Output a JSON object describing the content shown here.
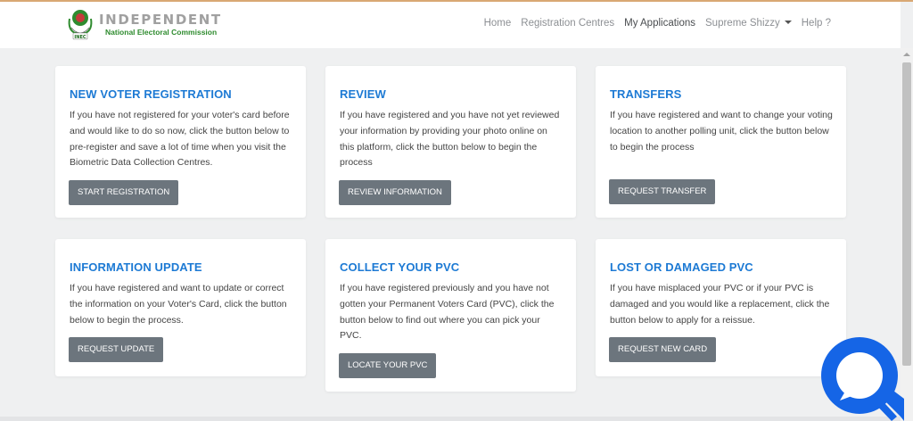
{
  "header": {
    "brand_title": "INDEPENDENT",
    "brand_subtitle": "National Electoral Commission",
    "logo_text": "INEC"
  },
  "nav": {
    "items": [
      {
        "label": "Home"
      },
      {
        "label": "Registration Centres"
      },
      {
        "label": "My Applications"
      },
      {
        "label": "Supreme Shizzy"
      },
      {
        "label": "Help ?"
      }
    ]
  },
  "cards": [
    {
      "title": "NEW VOTER REGISTRATION",
      "description": "If you have not registered for your voter's card before and would like to do so now, click the button below to pre-register and save a lot of time when you visit the Biometric Data Collection Centres.",
      "button": "START REGISTRATION"
    },
    {
      "title": "REVIEW",
      "description": "If you have registered and you have not yet reviewed your information by providing your photo online on this platform, click the button below to begin the process",
      "button": "REVIEW INFORMATION"
    },
    {
      "title": "TRANSFERS",
      "description": "If you have registered and want to change your voting location to another polling unit, click the button below to begin the process",
      "button": "REQUEST TRANSFER"
    },
    {
      "title": "INFORMATION UPDATE",
      "description": "If you have registered and want to update or correct the information on your Voter's Card, click the button below to begin the process.",
      "button": "REQUEST UPDATE"
    },
    {
      "title": "COLLECT YOUR PVC",
      "description": "If you have registered previously and you have not gotten your Permanent Voters Card (PVC), click the button below to find out where you can pick your PVC.",
      "button": "LOCATE YOUR PVC"
    },
    {
      "title": "LOST OR DAMAGED PVC",
      "description": "If you have misplaced your PVC or if your PVC is damaged and you would like a replacement, click the button below to apply for a reissue.",
      "button": "REQUEST NEW CARD"
    }
  ],
  "colors": {
    "accent": "#1d7ad4",
    "button": "#6c757d",
    "background": "#eff0f1",
    "brand_green": "#2e8b2e",
    "chat_widget": "#1565e6"
  },
  "icons": {
    "chat": "chat-search-icon",
    "nav_caret": "caret-down-icon"
  }
}
